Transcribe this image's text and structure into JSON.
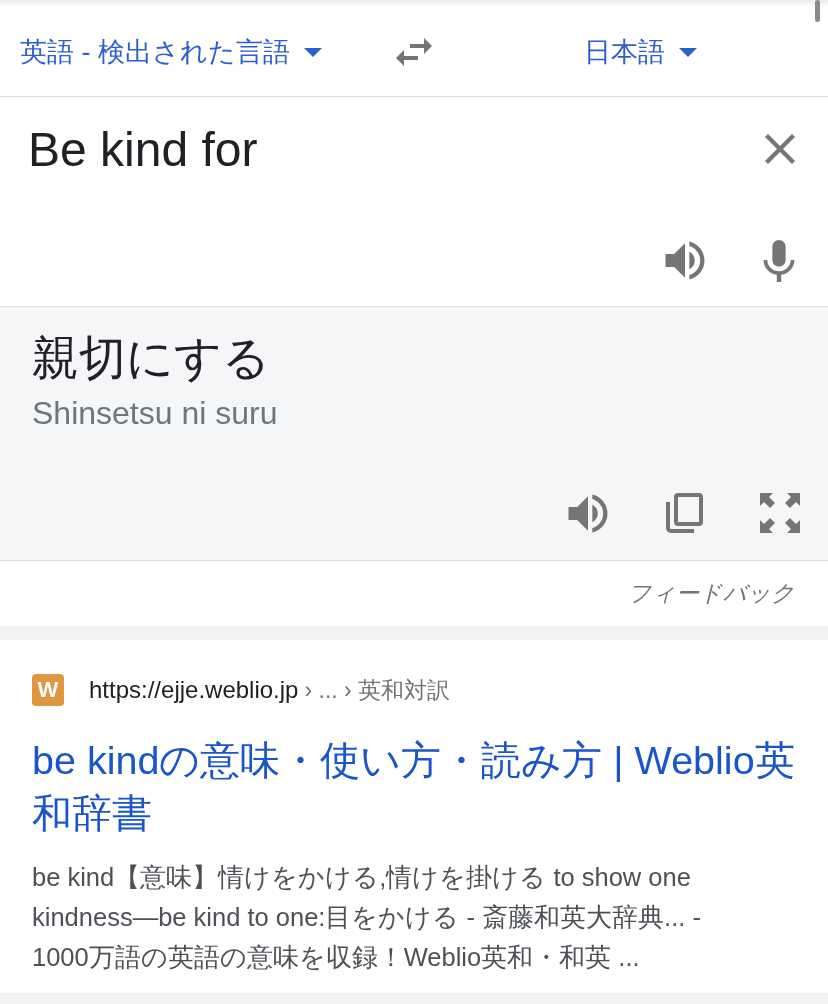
{
  "language_bar": {
    "source_language": "英語 - 検出された言語",
    "target_language": "日本語"
  },
  "input": {
    "value": "Be kind for"
  },
  "output": {
    "translation": "親切にする",
    "romanization": "Shinsetsu ni suru"
  },
  "feedback": "フィードバック",
  "result": {
    "logo_letter": "W",
    "url": "https://ejje.weblio.jp",
    "path": "› ... › 英和対訳",
    "title": "be kindの意味・使い方・読み方 | Weblio英和辞書",
    "snippet": "be kind【意味】情けをかける,情けを掛ける to show one kindness—be kind to one:目をかける - 斎藤和英大辞典... - 1000万語の英語の意味を収録！Weblio英和・和英 ..."
  }
}
